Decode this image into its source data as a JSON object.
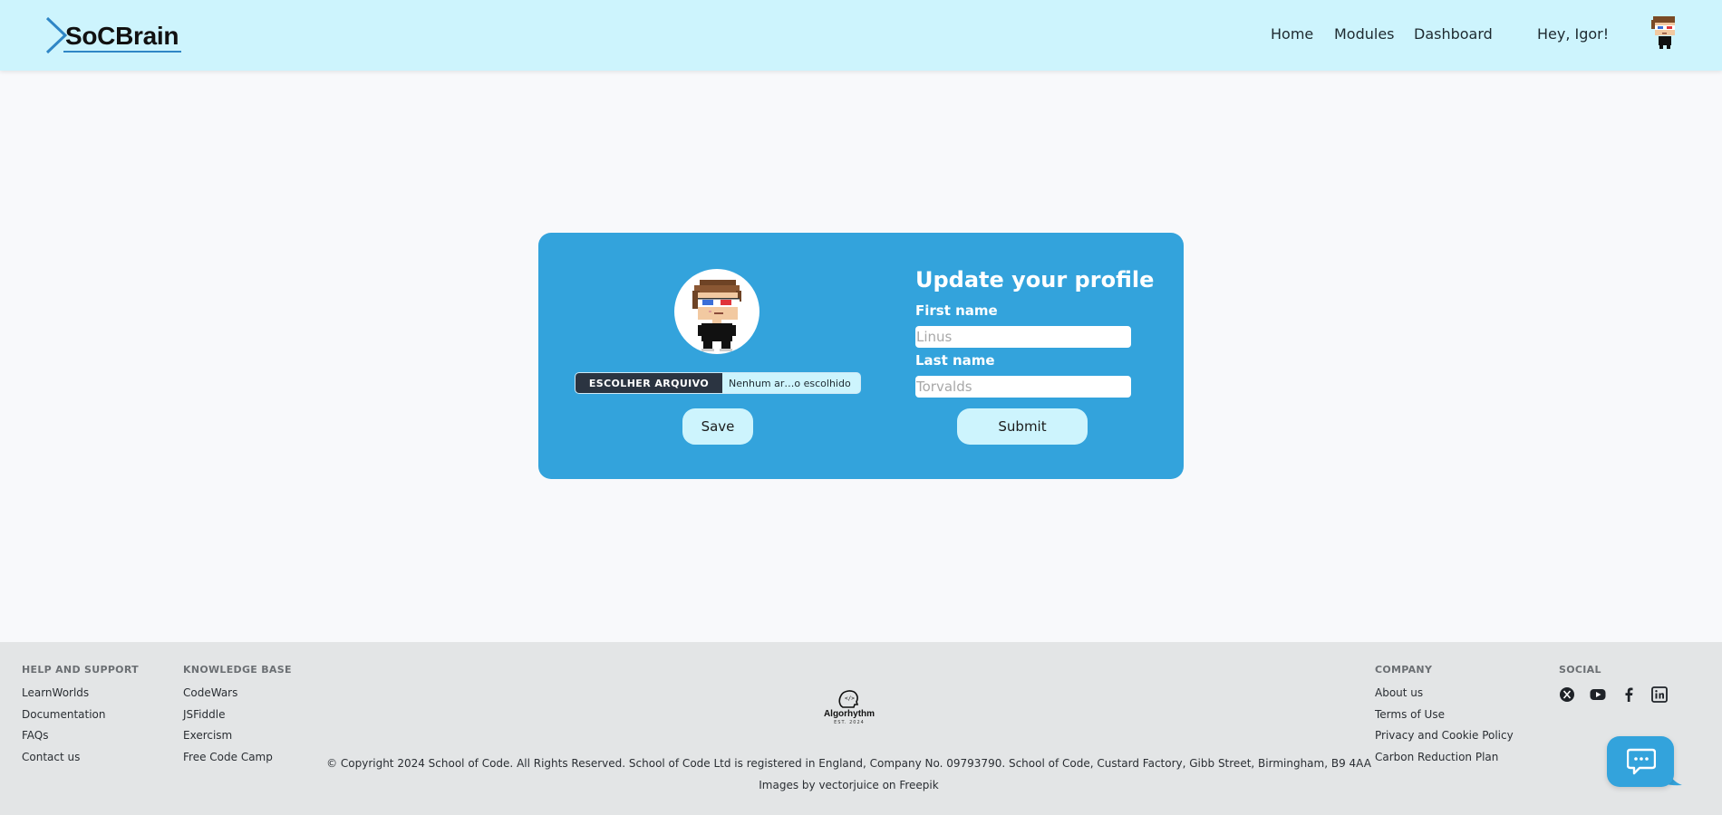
{
  "header": {
    "logo_text": "SoCBrain",
    "nav": {
      "home": "Home",
      "modules": "Modules",
      "dashboard": "Dashboard"
    },
    "greeting": "Hey, Igor!"
  },
  "profile_card": {
    "file_button_label": "ESCOLHER ARQUIVO",
    "file_name": "Nenhum ar…o escolhido",
    "save_label": "Save",
    "title": "Update your profile",
    "first_name_label": "First name",
    "first_name_placeholder": "Linus",
    "first_name_value": "",
    "last_name_label": "Last name",
    "last_name_placeholder": "Torvalds",
    "last_name_value": "",
    "submit_label": "Submit"
  },
  "footer": {
    "help": {
      "heading": "HELP AND SUPPORT",
      "links": [
        "LearnWorlds",
        "Documentation",
        "FAQs",
        "Contact us"
      ]
    },
    "knowledge": {
      "heading": "KNOWLEDGE BASE",
      "links": [
        "CodeWars",
        "JSFiddle",
        "Exercism",
        "Free Code Camp"
      ]
    },
    "company": {
      "heading": "COMPANY",
      "links": [
        "About us",
        "Terms of Use",
        "Privacy and Cookie Policy",
        "Carbon Reduction Plan"
      ]
    },
    "social": {
      "heading": "SOCIAL",
      "icons": [
        "x-icon",
        "youtube-icon",
        "facebook-icon",
        "linkedin-icon"
      ]
    },
    "brand_name": "Algorhythm",
    "brand_sub": "EST. 2024",
    "copyright": "© Copyright 2024 School of Code. All Rights Reserved. School of Code Ltd is registered in England, Company No. 09793790. School of Code, Custard Factory, Gibb Street, Birmingham, B9 4AA",
    "credits": "Images by vectorjuice on Freepik"
  },
  "colors": {
    "header_bg": "#cdf4fd",
    "card_bg": "#33a3dc",
    "footer_bg": "#e3e5e6",
    "page_bg": "#f8f9fb"
  }
}
